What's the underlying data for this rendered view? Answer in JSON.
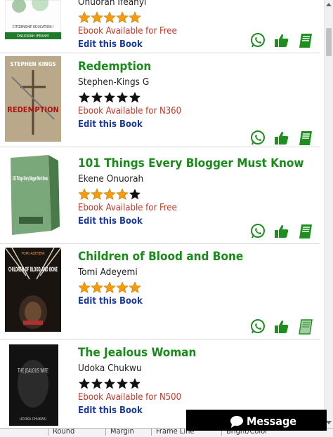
{
  "books": [
    {
      "title": "",
      "author": "Onuorah Ifeanyi",
      "rating": 5,
      "availability": "Ebook Available for Free",
      "edit_label": "Edit this Book",
      "cover_text": "CITIZENSHIP EDUCATION I",
      "cover_subtext": "ONUORAH IFEANYI"
    },
    {
      "title": "Redemption",
      "author": "Stephen-Kings G",
      "rating": 5,
      "availability": "Ebook Available for N360",
      "edit_label": "Edit this Book",
      "cover_text": "STEPHEN KINGS",
      "cover_subtext": "REDEMPTION"
    },
    {
      "title": "101 Things Every Blogger Must Know",
      "author": "Ekene Onuorah",
      "rating": 4,
      "availability": "Ebook Available for Free",
      "edit_label": "Edit this Book",
      "cover_text": "101 Things Every Blogger Must Know",
      "cover_subtext": ""
    },
    {
      "title": "Children of Blood and Bone",
      "author": "Tomi Adeyemi",
      "rating": 5,
      "availability": "",
      "edit_label": "Edit this Book",
      "cover_text": "CHILDREN OF BLOOD AND BONE",
      "cover_subtext": "TOMI ADEYEMI"
    },
    {
      "title": "The Jealous Woman",
      "author": "Udoka Chukwu",
      "rating": 5,
      "availability": "Ebook Available for N500",
      "edit_label": "Edit this Book",
      "cover_text": "THE JEALOUS WIFE",
      "cover_subtext": "UDOKA CHUKWU"
    }
  ],
  "message_button": {
    "label": "Message",
    "icon": "chat-bubble-icon"
  },
  "bottom_bar": [
    "Round",
    "Margin",
    "Frame Line",
    "Bright/Color"
  ],
  "colors": {
    "title": "#1a8a1a",
    "availability": "#c0392b",
    "edit_link": "#1a3aa0",
    "star_orange": "#f39c12",
    "star_black": "#111111",
    "action_green": "#1e8f1e"
  }
}
